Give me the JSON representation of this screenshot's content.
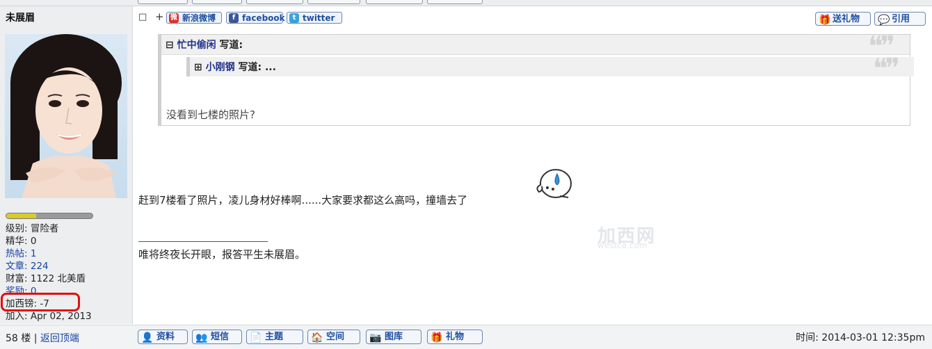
{
  "user": {
    "name": "未展眉",
    "progress": 0.35,
    "stats": [
      {
        "label": "级别:",
        "value": "冒险者",
        "link": false
      },
      {
        "label": "精华:",
        "value": "0",
        "link": false
      },
      {
        "label": "热帖:",
        "value": "1",
        "link": true
      },
      {
        "label": "文章:",
        "value": "224",
        "link": true
      },
      {
        "label": "财富:",
        "value": "1122 北美盾",
        "link": false
      },
      {
        "label": "奖励:",
        "value": "0",
        "link": true
      },
      {
        "label": "加西镑:",
        "value": "-7",
        "link": false
      },
      {
        "label": "加入:",
        "value": "Apr 02, 2013",
        "link": false
      }
    ]
  },
  "toolbar": {
    "page_icon": "□",
    "plus": "+",
    "share_weibo": "新浪微博",
    "share_facebook": "facebook",
    "share_twitter": "twitter",
    "gift_label": "送礼物",
    "quote_label": "引用"
  },
  "quote": {
    "toggle_outer": "⊟",
    "author_outer": "忙中偷闲",
    "said": "写道:",
    "toggle_inner": "⊞",
    "author_inner": "小刚钢",
    "said_inner": "写道: ...",
    "text": "没看到七楼的照片?"
  },
  "post": {
    "body": "赶到7楼看了照片，凌儿身材好棒啊......大家要求都这么高吗，撞墙去了",
    "signature": "唯将终夜长开眼，报答平生未展眉。",
    "watermark_main": "加西网",
    "watermark_sub": "westca.com"
  },
  "footer": {
    "floor": "58 楼",
    "sep": "|",
    "back_to_top": "返回顶端",
    "buttons": [
      "资料",
      "短信",
      "主题",
      "空间",
      "图库",
      "礼物"
    ],
    "time": "时间: 2014-03-01 12:35pm"
  },
  "colors": {
    "accent": "#1f4fa0",
    "highlight": "#e01010",
    "bar_fill": "#d8cc2a"
  }
}
